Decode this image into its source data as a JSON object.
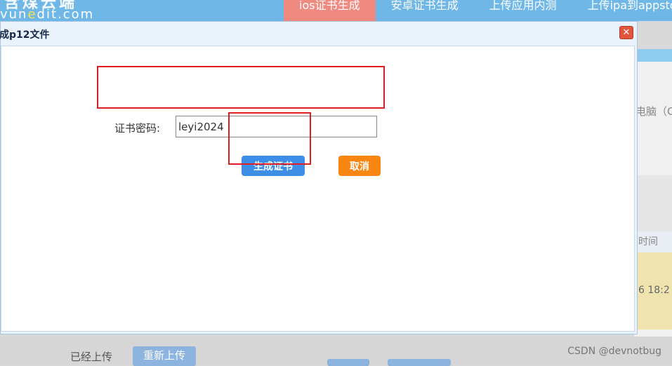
{
  "header": {
    "logo_top": "含煤云端",
    "logo_url_prefix": "vun",
    "logo_url_highlight": "e",
    "logo_url_suffix": "dit.com",
    "nav": [
      {
        "label": "ios证书生成",
        "active": true
      },
      {
        "label": "安卓证书生成",
        "active": false
      },
      {
        "label": "上传应用内测",
        "active": false
      },
      {
        "label": "上传ipa到appsto",
        "active": false
      }
    ]
  },
  "background": {
    "text_computer": "电脑（C",
    "text_time": "时间",
    "text_date": "6 18:2",
    "uploaded_label": "已经上传",
    "reupload_label": "重新上传",
    "watermark": "CSDN @devnotbug"
  },
  "modal": {
    "title": "成p12文件",
    "close_icon": "close-icon",
    "password_label": "证书密码:",
    "password_value": "leyi2024",
    "generate_label": "生成证书",
    "cancel_label": "取消"
  },
  "colors": {
    "header_bg": "#6eb7e6",
    "nav_active": "#ee8a80",
    "generate_btn": "#3d8ee6",
    "cancel_btn": "#f98512",
    "annotation_red": "#e21c23"
  }
}
